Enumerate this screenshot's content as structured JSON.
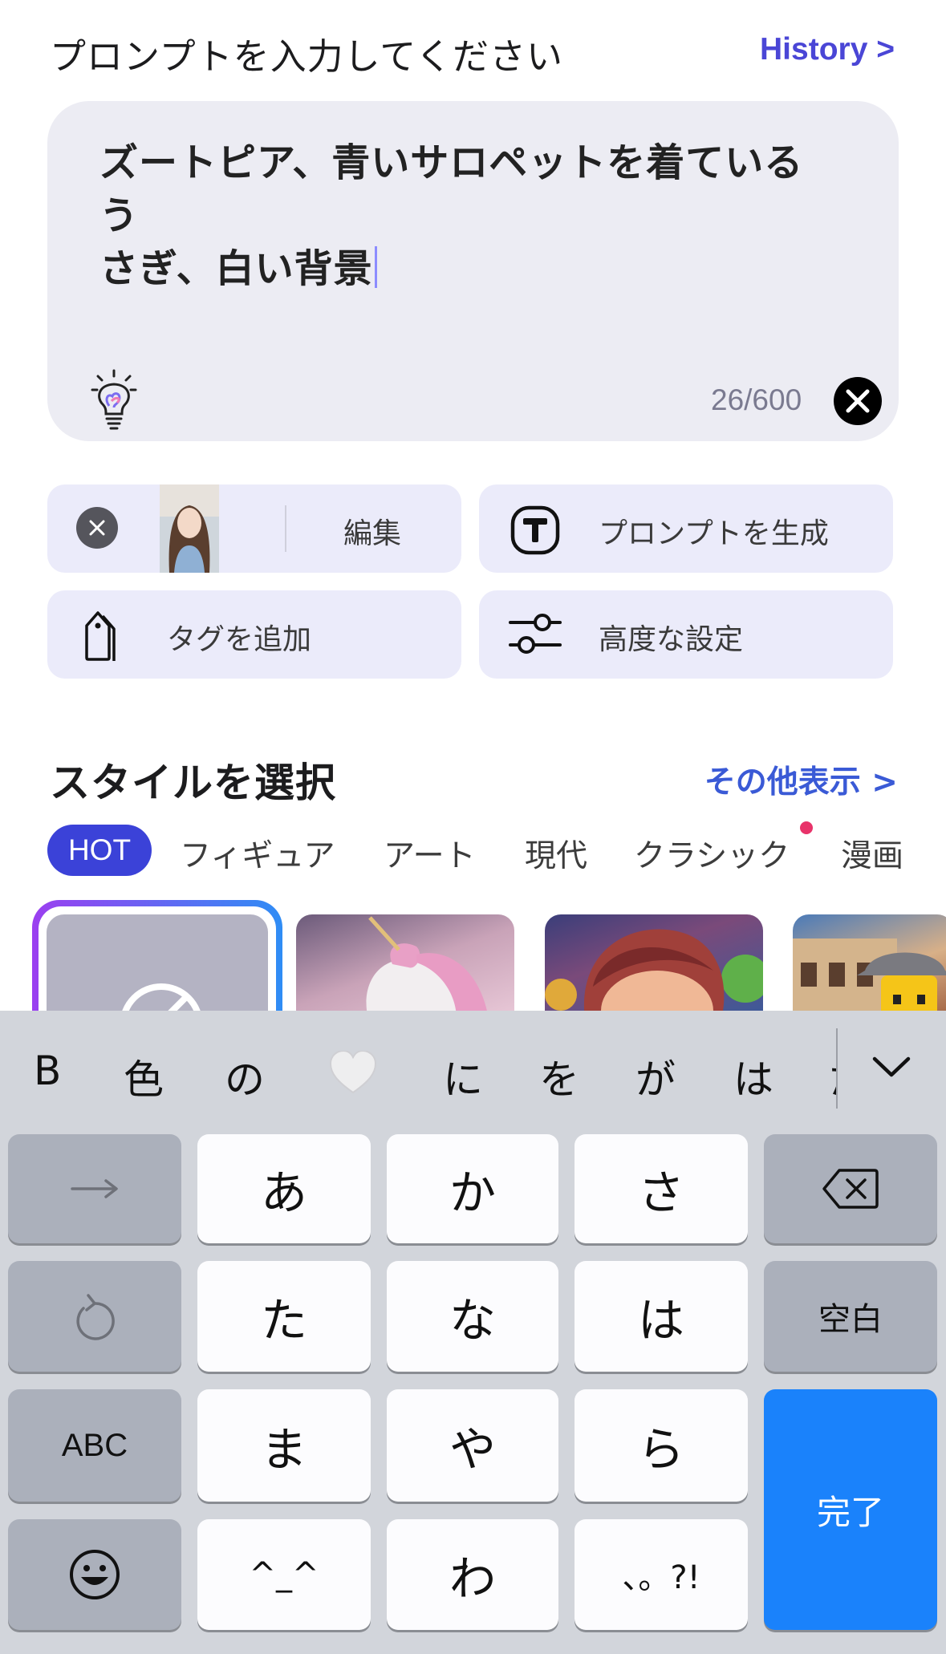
{
  "header": {
    "prompt_heading": "プロンプトを入力してください",
    "history_link": "History >"
  },
  "prompt": {
    "line1": "ズートピア、青いサロペットを着ているう",
    "line2": "さぎ、白い背景",
    "char_count": "26/600"
  },
  "actions": {
    "edit": "編集",
    "generate_prompt": "プロンプトを生成",
    "add_tag": "タグを追加",
    "advanced": "高度な設定"
  },
  "style_section": {
    "heading": "スタイルを選択",
    "more_link": "その他表示 >",
    "tabs": [
      "HOT",
      "フィギュア",
      "アート",
      "現代",
      "クラシック",
      "漫画"
    ],
    "selected_tab": "HOT"
  },
  "keyboard": {
    "suggestions": [
      "B",
      "色",
      "の",
      "🤍",
      "に",
      "を",
      "が",
      "は",
      "た"
    ],
    "row1": [
      "→",
      "あ",
      "か",
      "さ",
      "⌫"
    ],
    "row2": [
      "↺",
      "た",
      "な",
      "は",
      "空白"
    ],
    "row3": [
      "ABC",
      "ま",
      "や",
      "ら"
    ],
    "row4": [
      "☺",
      "^_^",
      "わ",
      "、。?!"
    ],
    "done": "完了"
  },
  "colors": {
    "accent": "#4a46d6",
    "hot_tab": "#3b42d8",
    "done_key": "#1a82fb",
    "new_dot": "#e8336a"
  }
}
